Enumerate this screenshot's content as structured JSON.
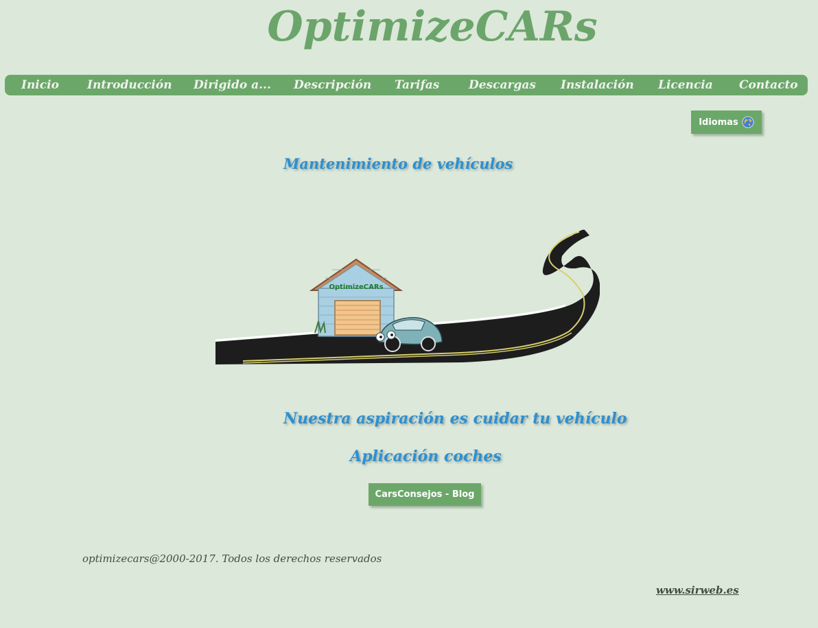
{
  "site": {
    "title": "OptimizeCARs"
  },
  "nav": {
    "items": [
      {
        "label": "Inicio"
      },
      {
        "label": "Introducción"
      },
      {
        "label": "Dirigido a..."
      },
      {
        "label": "Descripción"
      },
      {
        "label": "Tarifas"
      },
      {
        "label": "Descargas"
      },
      {
        "label": "Instalación"
      },
      {
        "label": "Licencia"
      },
      {
        "label": "Contacto"
      }
    ]
  },
  "language": {
    "label": "Idiomas",
    "icon": "globe-icon"
  },
  "main": {
    "heading": "Mantenimiento de vehículos",
    "illustration": {
      "garage_sign": "OptimizeCARs"
    },
    "slogan": "Nuestra aspiración es cuidar tu vehículo",
    "subheading": "Aplicación coches",
    "blog_button": "CarsConsejos - Blog"
  },
  "footer": {
    "copyright": "optimizecars@2000-2017. Todos los derechos reservados",
    "link": "www.sirweb.es"
  },
  "colors": {
    "background": "#dce8da",
    "accent_green": "#6ca76a",
    "heading_blue": "#2e8fd0"
  }
}
